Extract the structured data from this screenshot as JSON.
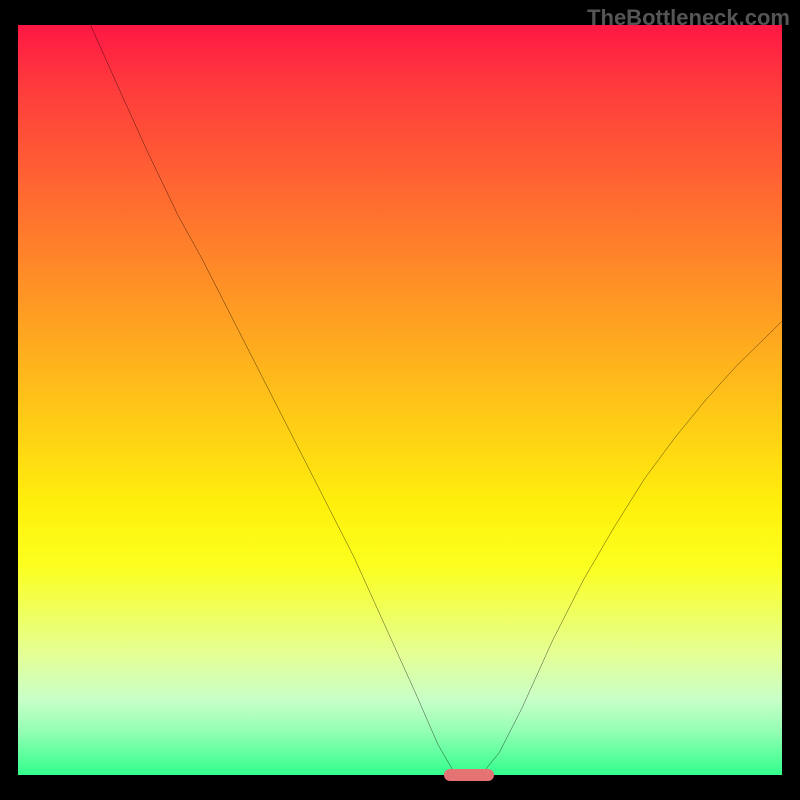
{
  "watermark": "TheBottleneck.com",
  "chart_data": {
    "type": "line",
    "title": "",
    "xlabel": "",
    "ylabel": "",
    "xlim": [
      0,
      100
    ],
    "ylim": [
      0,
      100
    ],
    "curve_points": [
      {
        "x": 9.5,
        "y": 100
      },
      {
        "x": 13,
        "y": 92
      },
      {
        "x": 17,
        "y": 83
      },
      {
        "x": 21,
        "y": 74.5
      },
      {
        "x": 24,
        "y": 69
      },
      {
        "x": 28,
        "y": 61
      },
      {
        "x": 32,
        "y": 53
      },
      {
        "x": 36,
        "y": 45
      },
      {
        "x": 40,
        "y": 37
      },
      {
        "x": 44,
        "y": 29
      },
      {
        "x": 48,
        "y": 20
      },
      {
        "x": 52,
        "y": 11
      },
      {
        "x": 55,
        "y": 4
      },
      {
        "x": 57,
        "y": 0.5
      },
      {
        "x": 59,
        "y": 0
      },
      {
        "x": 61,
        "y": 0.5
      },
      {
        "x": 63,
        "y": 3
      },
      {
        "x": 66,
        "y": 9
      },
      {
        "x": 70,
        "y": 18
      },
      {
        "x": 74,
        "y": 26
      },
      {
        "x": 78,
        "y": 33
      },
      {
        "x": 82,
        "y": 39.5
      },
      {
        "x": 86,
        "y": 45
      },
      {
        "x": 90,
        "y": 50
      },
      {
        "x": 94,
        "y": 54.5
      },
      {
        "x": 98,
        "y": 58.5
      },
      {
        "x": 100,
        "y": 60.5
      }
    ],
    "marker": {
      "x_center": 59,
      "y": 0,
      "color": "#e57373"
    },
    "gradient_colors": {
      "top": "#ff1744",
      "bottom": "#32ff8c"
    }
  }
}
